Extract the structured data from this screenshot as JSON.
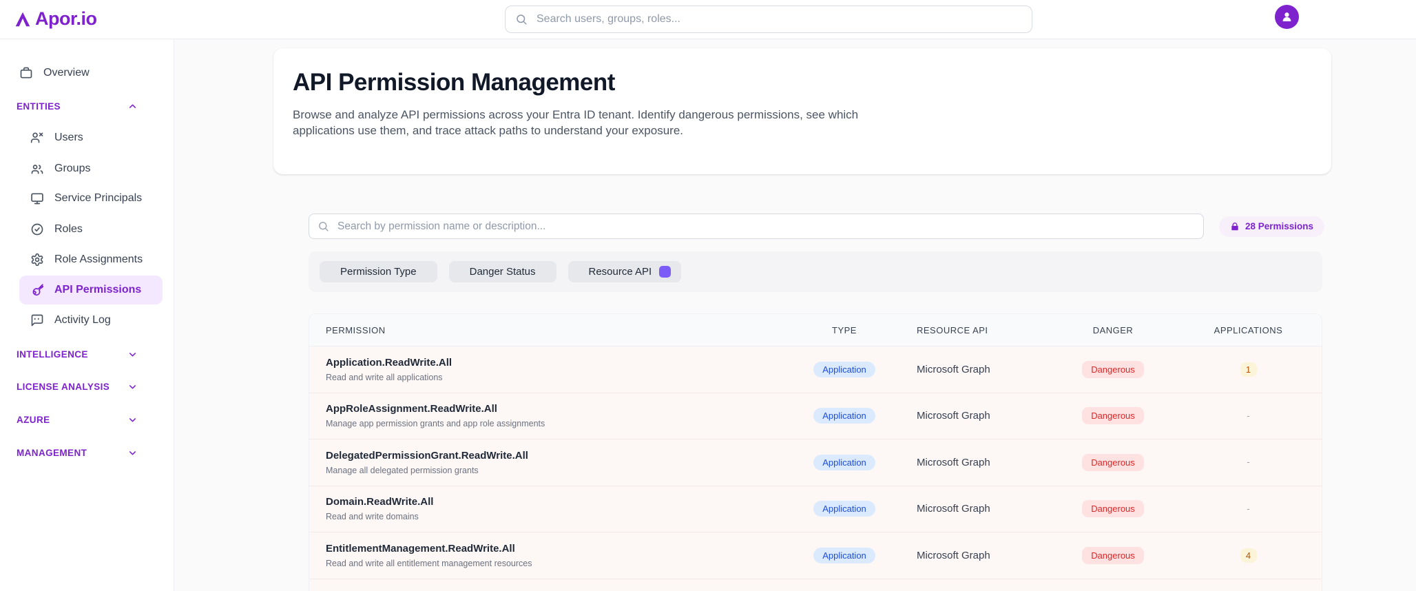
{
  "brand": {
    "name": "Apor.io"
  },
  "topbar": {
    "search_placeholder": "Search users, groups, roles..."
  },
  "sidebar": {
    "overview": {
      "label": "Overview"
    },
    "entities": {
      "label": "ENTITIES",
      "expanded": true,
      "items": [
        {
          "label": "Users",
          "icon": "user-x-icon"
        },
        {
          "label": "Groups",
          "icon": "users-icon"
        },
        {
          "label": "Service Principals",
          "icon": "monitor-icon"
        },
        {
          "label": "Roles",
          "icon": "check-circle-icon"
        },
        {
          "label": "Role Assignments",
          "icon": "gear-icon"
        },
        {
          "label": "API Permissions",
          "icon": "key-icon",
          "active": true
        },
        {
          "label": "Activity Log",
          "icon": "activity-log-icon"
        }
      ]
    },
    "collapsed_sections": [
      {
        "label": "INTELLIGENCE"
      },
      {
        "label": "LICENSE ANALYSIS"
      },
      {
        "label": "AZURE"
      },
      {
        "label": "MANAGEMENT"
      }
    ]
  },
  "page": {
    "title": "API Permission Management",
    "description": "Browse and analyze API permissions across your Entra ID tenant. Identify dangerous permissions, see which applications use them, and trace attack paths to understand your exposure."
  },
  "toolbar": {
    "search_placeholder": "Search by permission name or description...",
    "permissions_count": "28 Permissions",
    "filters": [
      {
        "label": "Permission Type"
      },
      {
        "label": "Danger Status"
      },
      {
        "label": "Resource API",
        "has_swatch": true,
        "swatch_color": "#7c5cf6"
      }
    ]
  },
  "table": {
    "columns": [
      "PERMISSION",
      "TYPE",
      "RESOURCE API",
      "DANGER",
      "APPLICATIONS"
    ],
    "rows": [
      {
        "name": "Application.ReadWrite.All",
        "description": "Read and write all applications",
        "type": "Application",
        "resource_api": "Microsoft Graph",
        "danger": "Dangerous",
        "applications": "1"
      },
      {
        "name": "AppRoleAssignment.ReadWrite.All",
        "description": "Manage app permission grants and app role assignments",
        "type": "Application",
        "resource_api": "Microsoft Graph",
        "danger": "Dangerous",
        "applications": "-"
      },
      {
        "name": "DelegatedPermissionGrant.ReadWrite.All",
        "description": "Manage all delegated permission grants",
        "type": "Application",
        "resource_api": "Microsoft Graph",
        "danger": "Dangerous",
        "applications": "-"
      },
      {
        "name": "Domain.ReadWrite.All",
        "description": "Read and write domains",
        "type": "Application",
        "resource_api": "Microsoft Graph",
        "danger": "Dangerous",
        "applications": "-"
      },
      {
        "name": "EntitlementManagement.ReadWrite.All",
        "description": "Read and write all entitlement management resources",
        "type": "Application",
        "resource_api": "Microsoft Graph",
        "danger": "Dangerous",
        "applications": "4"
      }
    ]
  },
  "colors": {
    "accent": "#7e22ce",
    "accent_soft": "#f3e8ff",
    "swatch": "#7c5cf6",
    "type_bg": "#dbeafe",
    "type_text": "#1d4ed8",
    "danger_bg": "#fee2e2",
    "danger_text": "#dc2626",
    "count_bg": "#fcf4d9",
    "count_text": "#b45309",
    "row_bg": "#fdf7f5"
  }
}
